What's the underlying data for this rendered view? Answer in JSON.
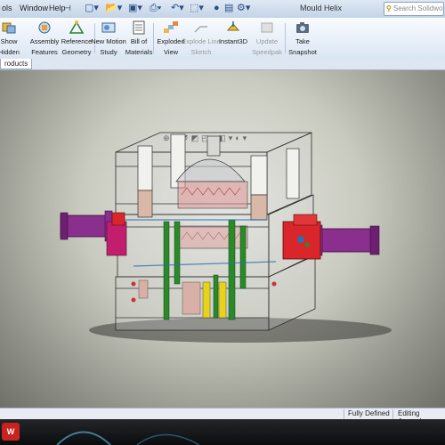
{
  "menubar": {
    "items": [
      {
        "label": "ols",
        "x": 2
      },
      {
        "label": "Window",
        "x": 22
      },
      {
        "label": "Help",
        "x": 55
      }
    ],
    "document_title": "Mould Helix",
    "search_placeholder": "Search Solidwo"
  },
  "ribbon": {
    "buttons": [
      {
        "label": "Show Hidden Components",
        "icon": "show-hidden-icon",
        "disabled": false
      },
      {
        "label": "Assembly Features",
        "icon": "assembly-features-icon",
        "disabled": false
      },
      {
        "label": "Reference Geometry",
        "icon": "reference-geometry-icon",
        "disabled": false
      },
      {
        "label": "New Motion Study",
        "icon": "motion-study-icon",
        "disabled": false
      },
      {
        "label": "Bill of Materials",
        "icon": "bom-icon",
        "disabled": false
      },
      {
        "label": "Exploded View",
        "icon": "exploded-view-icon",
        "disabled": false
      },
      {
        "label": "Explode Line Sketch",
        "icon": "explode-line-icon",
        "disabled": true
      },
      {
        "label": "Instant3D",
        "icon": "instant3d-icon",
        "disabled": false
      },
      {
        "label": "Update Speedpak",
        "icon": "speedpak-icon",
        "disabled": true
      },
      {
        "label": "Take Snapshot",
        "icon": "snapshot-icon",
        "disabled": false
      }
    ]
  },
  "tabs": {
    "active": "roducts"
  },
  "status": {
    "state": "Fully Defined",
    "mode": "Editing Assemb"
  },
  "taskbar": {
    "start_label": "W"
  },
  "colors": {
    "ribbon_bg": "#dbe6f3",
    "viewport_center": "#e9e9e4",
    "cylinder_purple": "#8a2f8e",
    "cylinder_red": "#d9262a",
    "pin_green": "#2a8a2a",
    "pin_yellow": "#e8d21a",
    "sleeve_pink": "#d8b0a8"
  }
}
